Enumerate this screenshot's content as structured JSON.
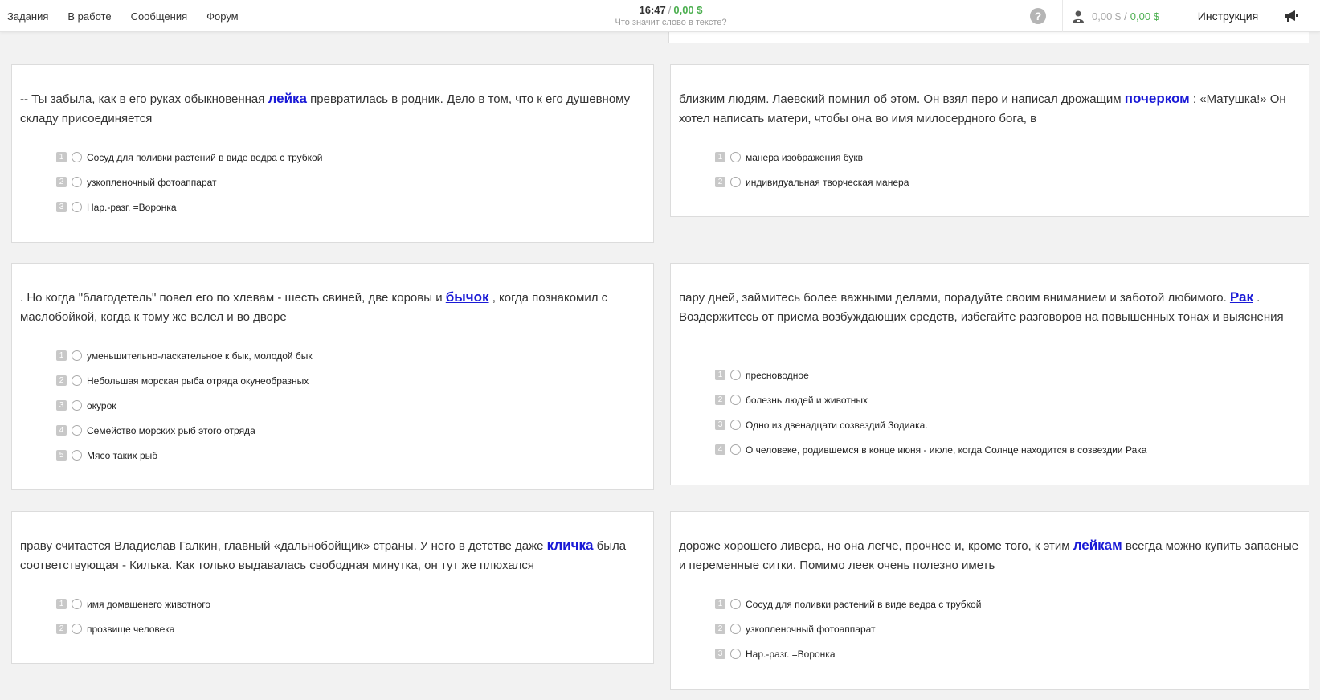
{
  "nav": {
    "tasks": "Задания",
    "in_progress": "В работе",
    "messages": "Сообщения",
    "forum": "Форум"
  },
  "status": {
    "time": "16:47",
    "separator": "/",
    "earned": "0,00 $",
    "task_title": "Что значит слово в тексте?"
  },
  "help_label": "?",
  "balance": {
    "pending": "0,00 $",
    "separator": "/",
    "available": "0,00 $"
  },
  "instructions_label": "Инструкция",
  "colors": {
    "money": "#4caf50",
    "keyword": "#1a1ad6"
  },
  "icons": {
    "help": "question-icon",
    "balance": "user-wallet-icon",
    "news": "megaphone-icon"
  },
  "cards": [
    {
      "text_before": "-- Ты забыла, как в его руках обыкновенная ",
      "keyword": "лейка",
      "text_after": " превратилась в родник. Дело в том, что к его душевному складу присоединяется",
      "options": [
        {
          "num": "1",
          "label": "Сосуд для поливки растений в виде ведра с трубкой"
        },
        {
          "num": "2",
          "label": "узкопленочный фотоаппарат"
        },
        {
          "num": "3",
          "label": "Нар.-разг. =Воронка"
        }
      ]
    },
    {
      "text_before": "близким людям. Лаевский помнил об этом. Он взял перо и написал дрожащим ",
      "keyword": "почерком",
      "text_after": " : «Матушка!» Он хотел написать матери, чтобы она во имя милосердного бога, в",
      "options": [
        {
          "num": "1",
          "label": "манера изображения букв"
        },
        {
          "num": "2",
          "label": "индивидуальная творческая манера"
        }
      ]
    },
    {
      "text_before": ". Но когда \"благодетель\" повел его по хлевам - шесть свиней, две коровы и ",
      "keyword": "бычок",
      "text_after": " , когда познакомил с маслобойкой, когда к тому же велел и во дворе",
      "options": [
        {
          "num": "1",
          "label": "уменьшительно-ласкательное к бык, молодой бык"
        },
        {
          "num": "2",
          "label": "Небольшая морская рыба отряда окунеобразных"
        },
        {
          "num": "3",
          "label": "окурок"
        },
        {
          "num": "4",
          "label": "Семейство морских рыб этого отряда"
        },
        {
          "num": "5",
          "label": "Мясо таких рыб"
        }
      ]
    },
    {
      "text_before": "пару дней, займитесь более важными делами, порадуйте своим вниманием и заботой любимого. ",
      "keyword": "Рак",
      "text_after": " . Воздержитесь от приема возбуждающих средств, избегайте разговоров на повышенных тонах и выяснения",
      "options": [
        {
          "num": "1",
          "label": "пресноводное"
        },
        {
          "num": "2",
          "label": "болезнь людей и животных"
        },
        {
          "num": "3",
          "label": "Одно из двенадцати созвездий Зодиака."
        },
        {
          "num": "4",
          "label": "О человеке, родившемся в конце июня - июле, когда Солнце находится в созвездии Рака"
        }
      ]
    },
    {
      "text_before": "праву считается Владислав Галкин, главный «дальнобойщик» страны. У него в детстве даже ",
      "keyword": "кличка",
      "text_after": " была соответствующая - Килька. Как только выдавалась свободная минутка, он тут же плюхался",
      "options": [
        {
          "num": "1",
          "label": "имя домашенего животного"
        },
        {
          "num": "2",
          "label": "прозвище человека"
        }
      ]
    },
    {
      "text_before": "дороже хорошего ливера, но она легче, прочнее и, кроме того, к этим ",
      "keyword": "лейкам",
      "text_after": " всегда можно купить запасные и переменные ситки. Помимо леек очень полезно иметь",
      "options": [
        {
          "num": "1",
          "label": "Сосуд для поливки растений в виде ведра с трубкой"
        },
        {
          "num": "2",
          "label": "узкопленочный фотоаппарат"
        },
        {
          "num": "3",
          "label": "Нар.-разг. =Воронка"
        }
      ]
    }
  ]
}
